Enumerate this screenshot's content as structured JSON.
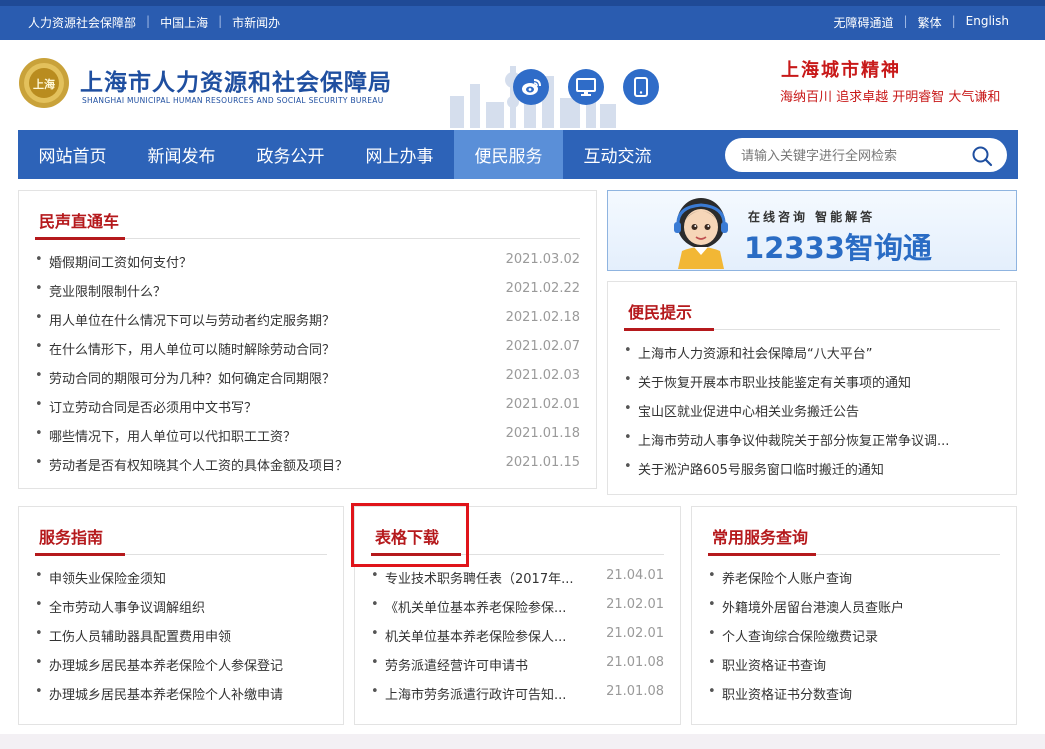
{
  "topbar": {
    "left_links": [
      "人力资源社会保障部",
      "中国上海",
      "市新闻办"
    ],
    "right_links": [
      "无障碍通道",
      "繁体",
      "English"
    ],
    "separator": "|"
  },
  "header": {
    "org_name": "上海市人力资源和社会保障局",
    "org_name_en": "SHANGHAI MUNICIPAL HUMAN RESOURCES AND SOCIAL SECURITY BUREAU",
    "emblem_text": "上海",
    "social_icons": [
      "weibo-icon",
      "desktop-icon",
      "mobile-icon"
    ],
    "spirit_title": "上海城市精神",
    "spirit_words": "海纳百川  追求卓越  开明睿智  大气谦和"
  },
  "nav": {
    "items": [
      {
        "label": "网站首页",
        "active": false
      },
      {
        "label": "新闻发布",
        "active": false
      },
      {
        "label": "政务公开",
        "active": false
      },
      {
        "label": "网上办事",
        "active": false
      },
      {
        "label": "便民服务",
        "active": true
      },
      {
        "label": "互动交流",
        "active": false
      }
    ],
    "search_placeholder": "请输入关键字进行全网检索",
    "search_value": ""
  },
  "minsheng": {
    "title": "民声直通车",
    "items": [
      {
        "text": "婚假期间工资如何支付？",
        "date": "2021.03.02"
      },
      {
        "text": "竞业限制限制什么？",
        "date": "2021.02.22"
      },
      {
        "text": "用人单位在什么情况下可以与劳动者约定服务期？",
        "date": "2021.02.18"
      },
      {
        "text": "在什么情形下，用人单位可以随时解除劳动合同？",
        "date": "2021.02.07"
      },
      {
        "text": "劳动合同的期限可分为几种？如何确定合同期限？",
        "date": "2021.02.03"
      },
      {
        "text": "订立劳动合同是否必须用中文书写？",
        "date": "2021.02.01"
      },
      {
        "text": "哪些情况下，用人单位可以代扣职工工资？",
        "date": "2021.01.18"
      },
      {
        "text": "劳动者是否有权知晓其个人工资的具体金额及项目？",
        "date": "2021.01.15"
      }
    ]
  },
  "banner": {
    "tagline": "在线咨询  智能解答",
    "name": "12333智询通"
  },
  "tips": {
    "title": "便民提示",
    "items": [
      {
        "text": "上海市人力资源和社会保障局“八大平台”"
      },
      {
        "text": "关于恢复开展本市职业技能鉴定有关事项的通知"
      },
      {
        "text": "宝山区就业促进中心相关业务搬迁公告"
      },
      {
        "text": "上海市劳动人事争议仲裁院关于部分恢复正常争议调..."
      },
      {
        "text": "关于淞沪路605号服务窗口临时搬迁的通知"
      }
    ]
  },
  "guide": {
    "title": "服务指南",
    "items": [
      {
        "text": "申领失业保险金须知"
      },
      {
        "text": "全市劳动人事争议调解组织"
      },
      {
        "text": "工伤人员辅助器具配置费用申领"
      },
      {
        "text": "办理城乡居民基本养老保险个人参保登记"
      },
      {
        "text": "办理城乡居民基本养老保险个人补缴申请"
      }
    ]
  },
  "forms": {
    "title": "表格下载",
    "items": [
      {
        "text": "专业技术职务聘任表（2017年...",
        "date": "21.04.01"
      },
      {
        "text": "《机关单位基本养老保险参保...",
        "date": "21.02.01"
      },
      {
        "text": "机关单位基本养老保险参保人...",
        "date": "21.02.01"
      },
      {
        "text": "劳务派遣经营许可申请书",
        "date": "21.01.08"
      },
      {
        "text": "上海市劳务派遣行政许可告知...",
        "date": "21.01.08"
      }
    ]
  },
  "query": {
    "title": "常用服务查询",
    "items": [
      {
        "text": "养老保险个人账户查询"
      },
      {
        "text": "外籍境外居留台港澳人员查账户"
      },
      {
        "text": "个人查询综合保险缴费记录"
      },
      {
        "text": "职业资格证书查询"
      },
      {
        "text": "职业资格证书分数查询"
      }
    ]
  },
  "colors": {
    "topbar": "#2a5cb0",
    "nav": "#2d63b8",
    "nav_active": "#5a8fd8",
    "title_red": "#b5191c",
    "highlight_red": "#e0141a"
  }
}
